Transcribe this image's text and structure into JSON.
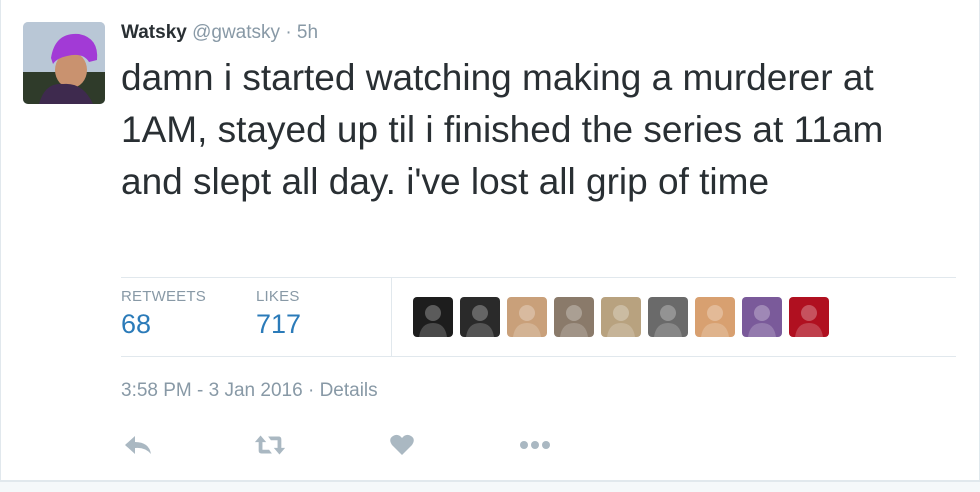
{
  "tweet": {
    "author_name": "Watsky",
    "author_handle": "@gwatsky",
    "separator": "·",
    "relative_time": "5h",
    "text": "damn i started watching making a murderer at 1AM, stayed up til i finished the series at 11am and slept all day. i've lost all grip of time"
  },
  "stats": {
    "retweets_label": "RETWEETS",
    "retweets_count": "68",
    "likes_label": "LIKES",
    "likes_count": "717"
  },
  "likers": [
    {
      "name": "liker-avatar",
      "color": "#1d1d1d"
    },
    {
      "name": "liker-avatar",
      "color": "#2a2a2a"
    },
    {
      "name": "liker-avatar",
      "color": "#c9a07a"
    },
    {
      "name": "liker-avatar",
      "color": "#8a7a6a"
    },
    {
      "name": "liker-avatar",
      "color": "#b8a27f"
    },
    {
      "name": "liker-avatar",
      "color": "#6a6a6a"
    },
    {
      "name": "liker-avatar",
      "color": "#d8a070"
    },
    {
      "name": "liker-avatar",
      "color": "#7a5a9a"
    },
    {
      "name": "liker-avatar",
      "color": "#b01020"
    }
  ],
  "meta": {
    "timestamp": "3:58 PM - 3 Jan 2016",
    "separator": "·",
    "details_link": "Details"
  },
  "actions": {
    "reply_icon": "reply-icon",
    "retweet_icon": "retweet-icon",
    "like_icon": "heart-icon",
    "more_icon": "more-icon"
  },
  "colors": {
    "accent": "#2b7bb9",
    "muted": "#8899a6",
    "text": "#292f33",
    "border": "#e1e8ed",
    "icon": "#aab8c2"
  }
}
